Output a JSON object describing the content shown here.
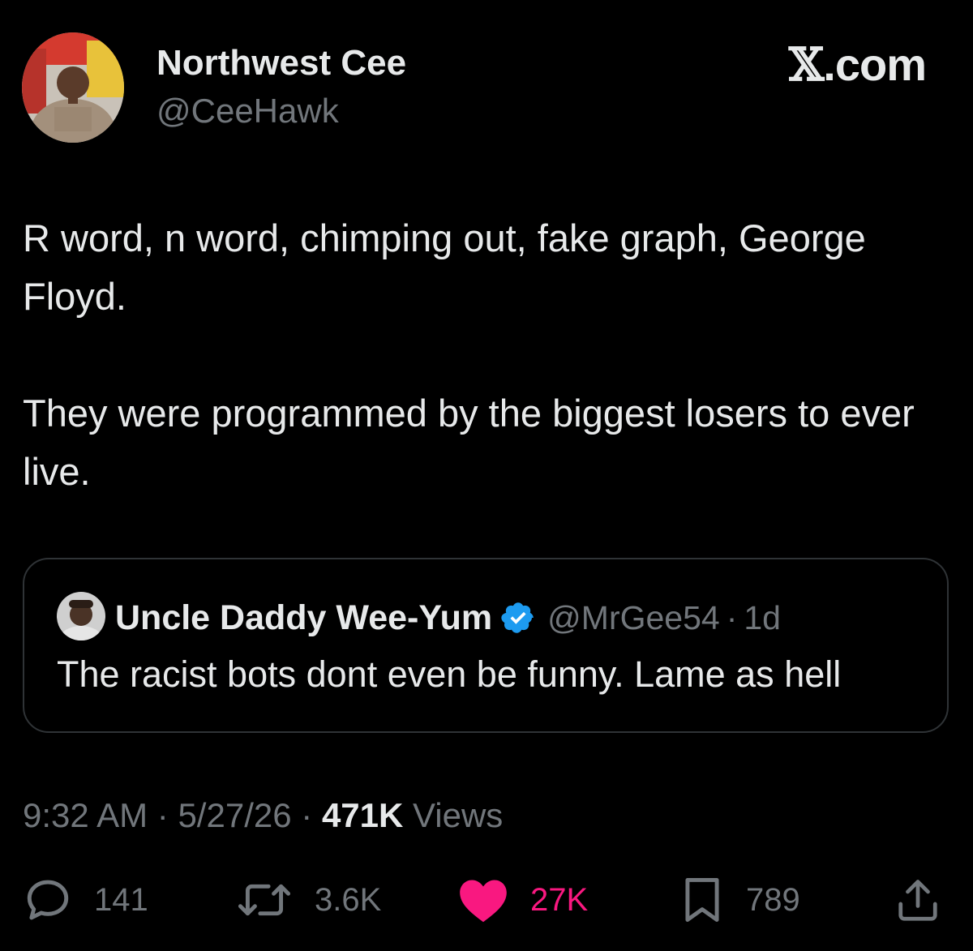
{
  "author": {
    "display_name": "Northwest Cee",
    "handle": "@CeeHawk",
    "avatar_icon": "user-photo-avatar"
  },
  "brand": {
    "glyph": "𝕏",
    "suffix": ".com"
  },
  "tweet": {
    "paragraphs": [
      "R word, n word, chimping out, fake graph, George Floyd.",
      "They were programmed by the biggest losers to ever live."
    ]
  },
  "quote": {
    "display_name": "Uncle Daddy Wee-Yum",
    "verified_icon": "verified-badge-icon",
    "handle": "@MrGee54",
    "separator": "·",
    "age": "1d",
    "text": "The racist bots dont even be funny. Lame as hell"
  },
  "meta": {
    "time": "9:32 AM",
    "date": "5/27/26",
    "separator": "·",
    "views_count": "471K",
    "views_label": "Views"
  },
  "actions": {
    "replies": "141",
    "reposts": "3.6K",
    "likes": "27K",
    "bookmarks": "789"
  },
  "colors": {
    "background": "#000000",
    "text_primary": "#e7e9ea",
    "text_secondary": "#71767b",
    "like_pink": "#f91880",
    "verified_blue": "#1d9bf0",
    "border": "#2f3336"
  }
}
